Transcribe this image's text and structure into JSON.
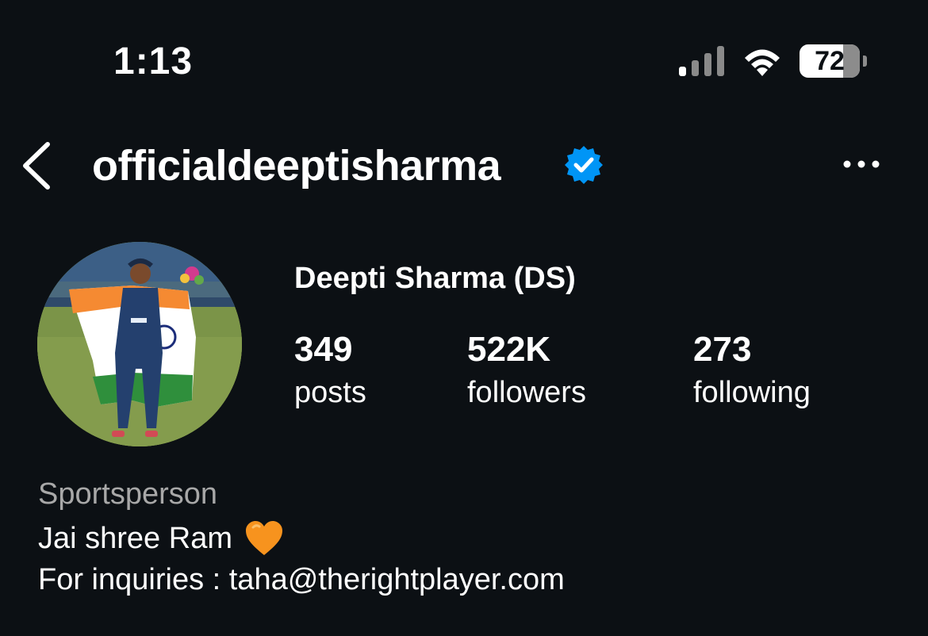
{
  "status_bar": {
    "time": "1:13",
    "battery": "72",
    "battery_level": 0.72
  },
  "header": {
    "username": "officialdeeptisharma",
    "verified": true
  },
  "profile": {
    "display_name": "Deepti Sharma (DS)",
    "stats": [
      {
        "count": "349",
        "label": "posts"
      },
      {
        "count": "522K",
        "label": "followers"
      },
      {
        "count": "273",
        "label": "following"
      }
    ],
    "category": "Sportsperson",
    "bio_line1": "Jai shree Ram",
    "bio_line1_emoji": "orange-heart-icon",
    "bio_line2": "For inquiries : taha@therightplayer.com"
  },
  "colors": {
    "background": "#0c1014",
    "text": "#ffffff",
    "secondary_text": "#a8a8a8",
    "verified_blue": "#0095f6",
    "heart_orange": "#f7931e"
  }
}
